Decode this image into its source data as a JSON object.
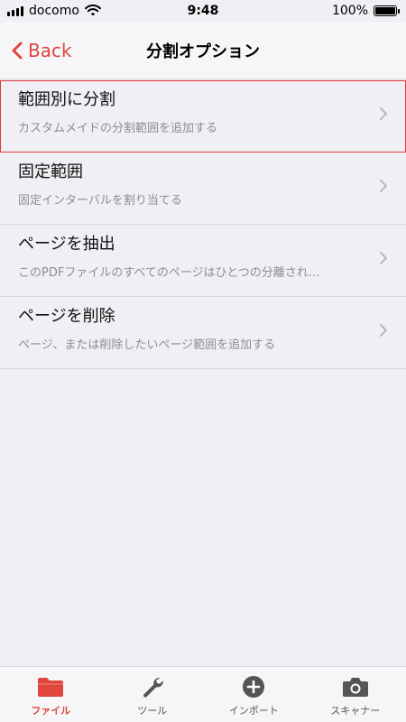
{
  "status_bar": {
    "carrier": "docomo",
    "time": "9:48",
    "battery": "100%"
  },
  "nav": {
    "back_label": "Back",
    "title": "分割オプション"
  },
  "options": [
    {
      "title": "範囲別に分割",
      "subtitle": "カスタムメイドの分割範囲を追加する",
      "highlighted": true
    },
    {
      "title": "固定範囲",
      "subtitle": "固定インターバルを割り当てる"
    },
    {
      "title": "ページを抽出",
      "subtitle": "このPDFファイルのすべてのページはひとつの分離され..."
    },
    {
      "title": "ページを削除",
      "subtitle": "ページ、または削除したいページ範囲を追加する"
    }
  ],
  "tabs": [
    {
      "label": "ファイル",
      "icon": "folder-icon",
      "active": true
    },
    {
      "label": "ツール",
      "icon": "wrench-icon"
    },
    {
      "label": "インポート",
      "icon": "plus-circle-icon"
    },
    {
      "label": "スキャナー",
      "icon": "camera-icon"
    }
  ],
  "colors": {
    "accent": "#e0453e",
    "highlight_border": "#e03a3a",
    "background": "#efeff4"
  }
}
